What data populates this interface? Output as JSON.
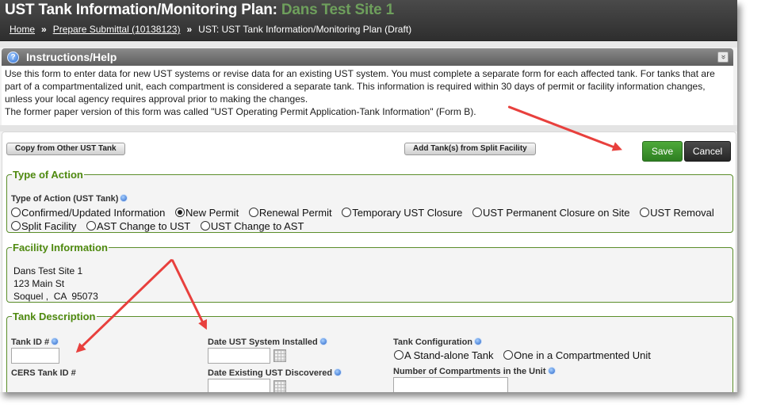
{
  "header": {
    "title_prefix": "UST Tank Information/Monitoring Plan: ",
    "site_name": "Dans Test Site 1",
    "breadcrumb": {
      "home": "Home",
      "sep": "»",
      "submittal": "Prepare Submittal (10138123)",
      "current": "UST: UST Tank Information/Monitoring Plan (Draft)"
    }
  },
  "help": {
    "title": "Instructions/Help",
    "collapse_icon": "»",
    "lines": [
      "Use this form to enter data for new UST systems or revise data for an existing UST system. You must complete a separate form for each affected tank. For tanks that are",
      "part of a compartmentalized unit, each compartment is considered a separate tank. This information is required within 30 days of permit or facility information changes,",
      "unless your local agency requires approval prior to making the changes.",
      "The former paper version of this form was called \"UST Operating Permit Application-Tank Information\" (Form B)."
    ]
  },
  "toolbar": {
    "copy_label": "Copy from Other UST Tank",
    "split_label": "Add Tank(s) from Split Facility",
    "save_label": "Save",
    "cancel_label": "Cancel"
  },
  "type_of_action": {
    "legend": "Type of Action",
    "label": "Type of Action (UST Tank)",
    "options_row1": [
      {
        "label": "Confirmed/Updated Information",
        "selected": false
      },
      {
        "label": "New Permit",
        "selected": true
      },
      {
        "label": "Renewal Permit",
        "selected": false
      },
      {
        "label": "Temporary UST Closure",
        "selected": false
      },
      {
        "label": "UST Permanent Closure on Site",
        "selected": false
      },
      {
        "label": "UST Removal",
        "selected": false
      }
    ],
    "options_row2": [
      {
        "label": "Split Facility",
        "selected": false
      },
      {
        "label": "AST Change to UST",
        "selected": false
      },
      {
        "label": "UST Change to AST",
        "selected": false
      }
    ]
  },
  "facility": {
    "legend": "Facility Information",
    "name": "Dans Test Site 1",
    "street": "123 Main St",
    "city_line": "Soquel ,  CA  95073"
  },
  "tank": {
    "legend": "Tank Description",
    "tank_id_label": "Tank ID #",
    "tank_id_value": "",
    "cers_label": "CERS Tank ID #",
    "date_installed_label": "Date UST System Installed",
    "date_installed_value": "",
    "date_discovered_label": "Date Existing UST Discovered",
    "config_label": "Tank Configuration",
    "config_options": [
      {
        "label": "A Stand-alone Tank",
        "selected": false
      },
      {
        "label": "One in a Compartmented Unit",
        "selected": false
      }
    ],
    "compartments_label": "Number of Compartments in the Unit"
  },
  "annotations": {
    "arrow_color": "#e8403d"
  }
}
